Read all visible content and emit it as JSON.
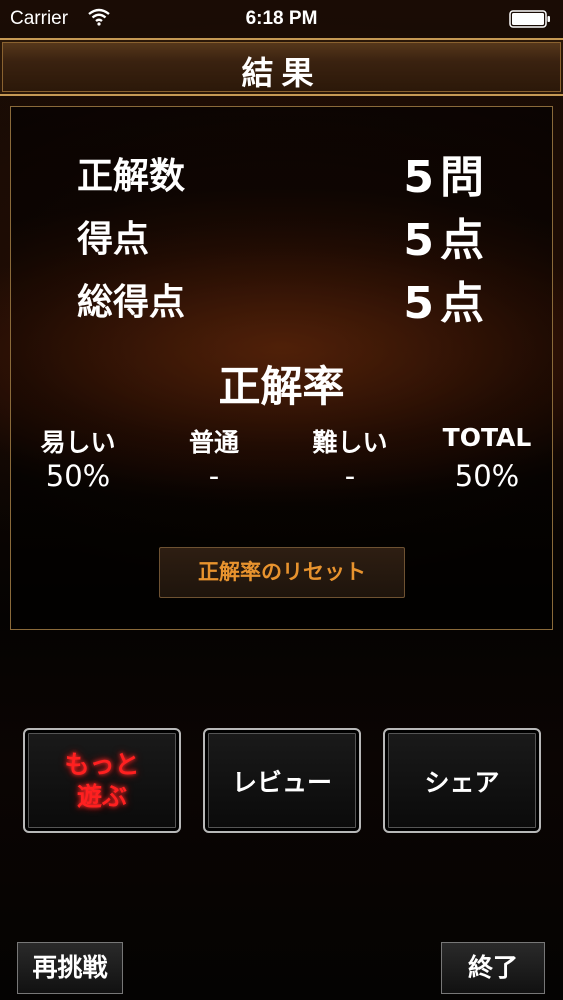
{
  "status_bar": {
    "carrier": "Carrier",
    "time": "6:18 PM"
  },
  "header": {
    "title": "結果"
  },
  "stats": [
    {
      "label": "正解数",
      "value": "5問"
    },
    {
      "label": "得点",
      "value": "5点"
    },
    {
      "label": "総得点",
      "value": "5点"
    }
  ],
  "rate": {
    "title": "正解率",
    "columns": [
      {
        "label": "易しい",
        "value": "50%"
      },
      {
        "label": "普通",
        "value": "-"
      },
      {
        "label": "難しい",
        "value": "-"
      },
      {
        "label": "TOTAL",
        "value": "50%"
      }
    ],
    "reset_label": "正解率のリセット"
  },
  "actions": {
    "play_more_line1": "もっと",
    "play_more_line2": "遊ぶ",
    "review": "レビュー",
    "share": "シェア"
  },
  "footer": {
    "retry": "再挑戦",
    "quit": "終了"
  },
  "colors": {
    "accent_orange": "#e8932e",
    "play_red": "#ff2020",
    "frame_gold": "#c69a55"
  }
}
